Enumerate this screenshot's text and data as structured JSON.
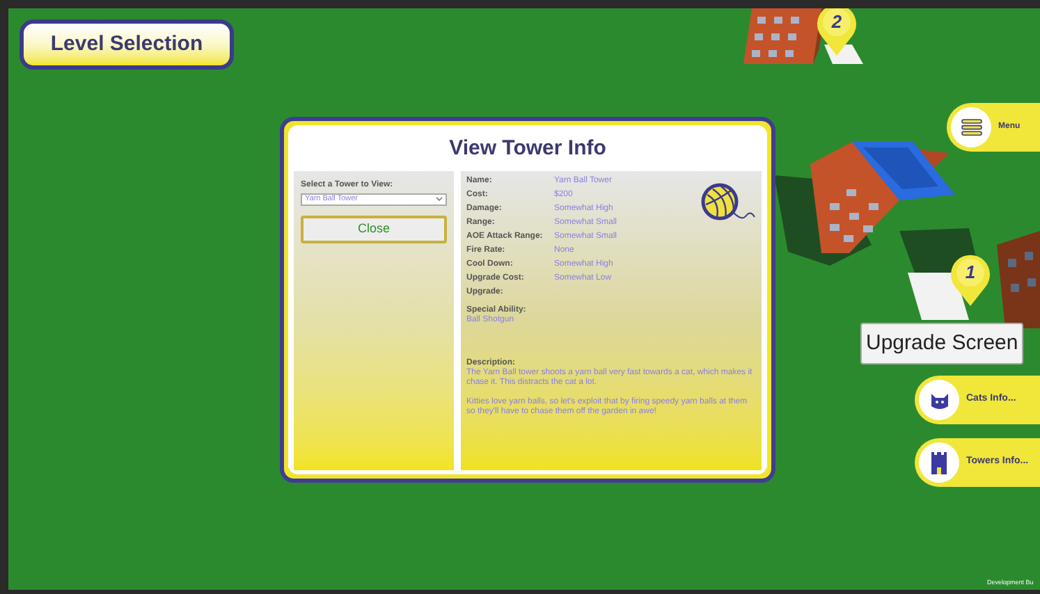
{
  "level_selection_button": {
    "label": "Level Selection"
  },
  "dialog": {
    "title": "View Tower Info",
    "select_label": "Select a Tower to View:",
    "select_value": "Yarn Ball Tower",
    "close_button": "Close",
    "stats": [
      {
        "label": "Name:",
        "value": "Yarn Ball Tower"
      },
      {
        "label": "Cost:",
        "value": "$200"
      },
      {
        "label": "Damage:",
        "value": "Somewhat High"
      },
      {
        "label": "Range:",
        "value": "Somewhat Small"
      },
      {
        "label": "AOE Attack Range:",
        "value": "Somewhat Small"
      },
      {
        "label": "Fire Rate:",
        "value": "None"
      },
      {
        "label": "Cool Down:",
        "value": "Somewhat High"
      },
      {
        "label": "Upgrade Cost:",
        "value": "Somewhat Low"
      },
      {
        "label": "Upgrade:"
      }
    ],
    "special_ability": {
      "label": "Special Ability:",
      "value": "Ball Shotgun"
    },
    "description": {
      "label": "Description:",
      "paragraphs": [
        "The Yarn Ball tower shoots a yarn ball very fast towards a cat, which makes it chase it. This distracts the cat a lot.",
        "Kitties love yarn balls, so let's exploit that by firing speedy yarn balls at them so they'll have to chase them off the garden in awe!"
      ]
    }
  },
  "level_pins": [
    {
      "label": "2"
    },
    {
      "label": "1"
    }
  ],
  "side_menu": [
    {
      "kind": "menu",
      "label": "Menu"
    },
    {
      "kind": "cats",
      "label": "Cats Info..."
    },
    {
      "kind": "towers",
      "label": "Towers Info..."
    }
  ],
  "tooltip": "Upgrade Screen",
  "build_label": "Development Bu"
}
